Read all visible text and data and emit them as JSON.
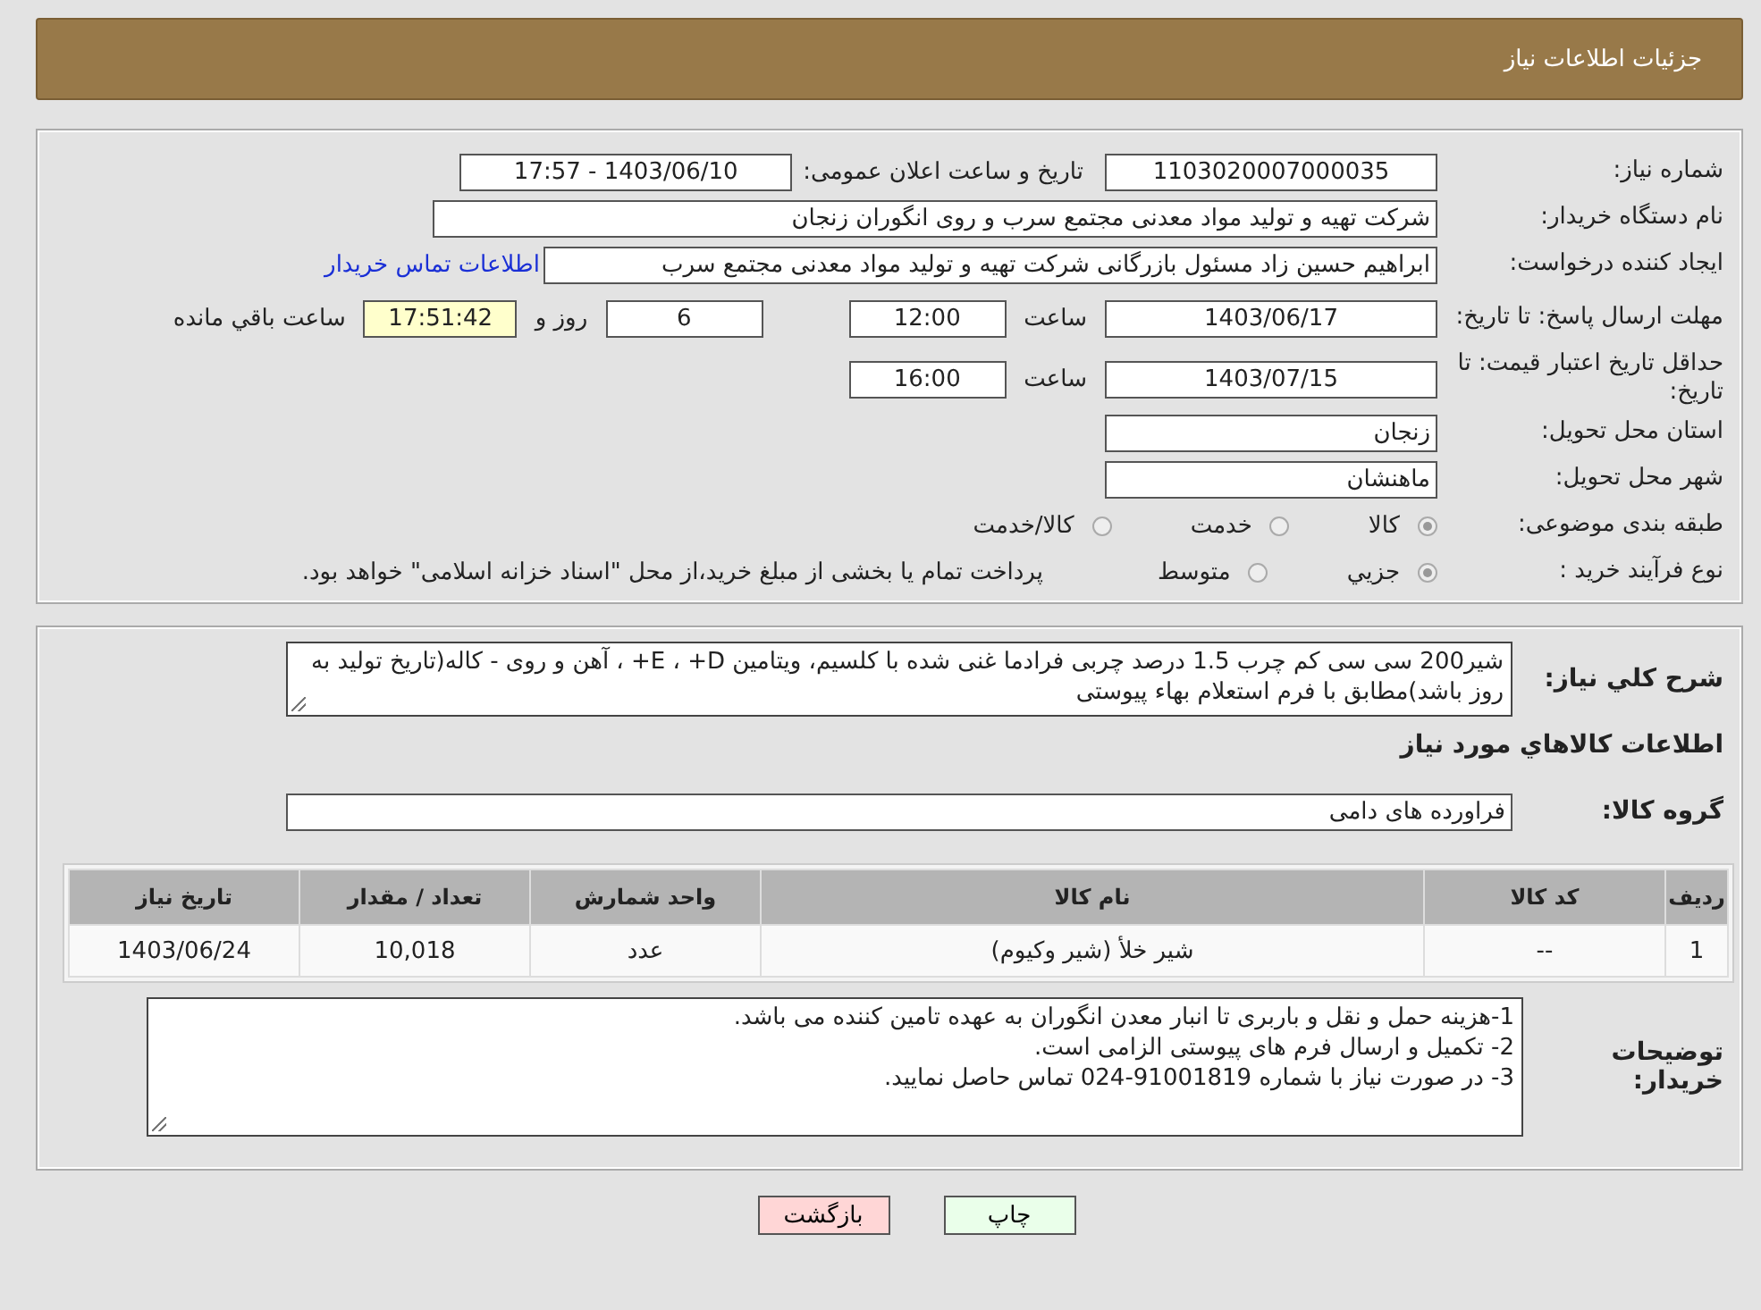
{
  "header": {
    "title": "جزئیات اطلاعات نیاز"
  },
  "need_number": {
    "label": "شماره نیاز:",
    "value": "1103020007000035"
  },
  "announce": {
    "label": "تاریخ و ساعت اعلان عمومی:",
    "value": "1403/06/10 - 17:57"
  },
  "buyer": {
    "label": "نام دستگاه خریدار:",
    "value": "شرکت تهیه و تولید مواد معدنی مجتمع سرب و روی انگوران   زنجان"
  },
  "creator": {
    "label": "ایجاد کننده درخواست:",
    "value": "ابراهیم حسین زاد مسئول بازرگانی شرکت تهیه و تولید مواد معدنی مجتمع سرب",
    "link": "اطلاعات تماس خریدار"
  },
  "deadline": {
    "label": "مهلت ارسال پاسخ: تا تاریخ:",
    "date": "1403/06/17",
    "time_label": "ساعت",
    "time": "12:00",
    "days": "6",
    "days_label": "روز و",
    "remaining": "17:51:42",
    "remaining_label": "ساعت باقي مانده"
  },
  "validity": {
    "label": "حداقل تاریخ اعتبار قیمت: تا تاریخ:",
    "date": "1403/07/15",
    "time_label": "ساعت",
    "time": "16:00"
  },
  "province": {
    "label": "استان محل تحویل:",
    "value": "زنجان"
  },
  "city": {
    "label": "شهر محل تحویل:",
    "value": "ماهنشان"
  },
  "category": {
    "label": "طبقه بندی موضوعی:",
    "options": [
      {
        "label": "کالا",
        "selected": true
      },
      {
        "label": "خدمت",
        "selected": false
      },
      {
        "label": "کالا/خدمت",
        "selected": false
      }
    ]
  },
  "process": {
    "label": "نوع فرآیند خرید :",
    "options": [
      {
        "label": "جزيي",
        "selected": true
      },
      {
        "label": "متوسط",
        "selected": false
      }
    ],
    "note": "پرداخت تمام یا بخشی از مبلغ خرید،از محل \"اسناد خزانه اسلامی\" خواهد بود."
  },
  "description": {
    "label": "شرح کلي نیاز:",
    "value": "شیر200 سی سی کم چرب 1.5 درصد چربی فرادما غنی شده با کلسیم، ویتامین E ، +D+ ، آهن و روی - کاله(تاریخ تولید به روز باشد)مطابق با فرم استعلام بهاء پیوستی"
  },
  "goods_heading": "اطلاعات کالاهاي مورد نیاز",
  "goods_group": {
    "label": "گروه کالا:",
    "value": "فراورده های دامی"
  },
  "table": {
    "columns": [
      "ردیف",
      "کد کالا",
      "نام کالا",
      "واحد شمارش",
      "تعداد / مقدار",
      "تاریخ نیاز"
    ],
    "rows": [
      [
        "1",
        "--",
        "شیر خلأ (شیر وکیوم)",
        "عدد",
        "10,018",
        "1403/06/24"
      ]
    ]
  },
  "buyer_notes": {
    "label": "توضیحات خریدار:",
    "lines": [
      "1-هزینه حمل و نقل و باربری تا انبار معدن انگوران به عهده تامین کننده می باشد.",
      "2- تکمیل و ارسال فرم های پیوستی الزامی است.",
      "3- در صورت نیاز با شماره 91001819-024 تماس حاصل نمایید."
    ]
  },
  "buttons": [
    {
      "label": "چاپ",
      "kind": "print"
    },
    {
      "label": "بازگشت",
      "kind": "back"
    }
  ]
}
